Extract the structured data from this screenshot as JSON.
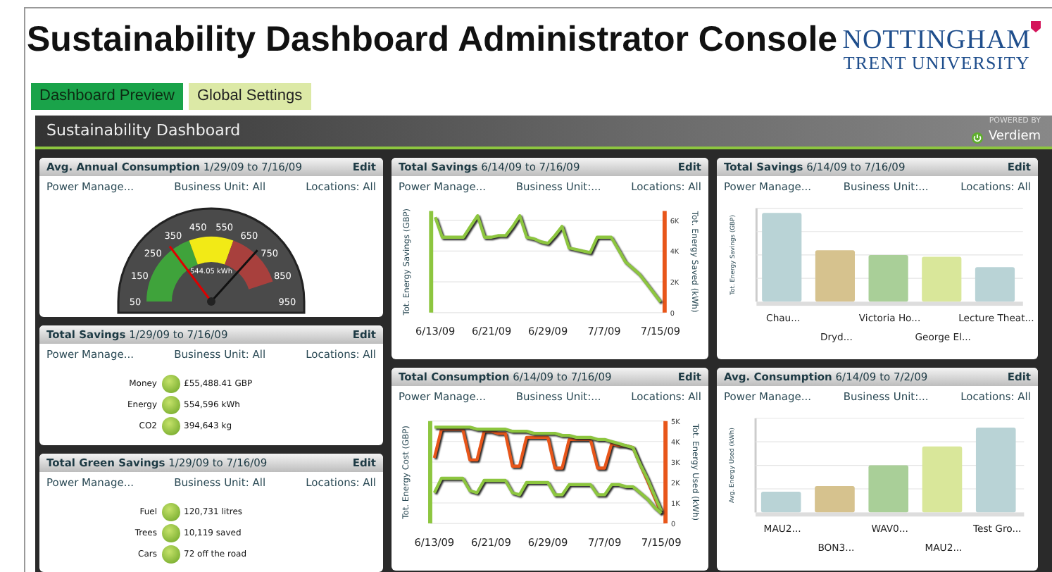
{
  "header": {
    "title": "Sustainability Dashboard Administrator Console",
    "logo": {
      "line1": "NOTTINGHAM",
      "line2": "TRENT UNIVERSITY"
    }
  },
  "tabs": [
    {
      "label": "Dashboard Preview",
      "selected": true
    },
    {
      "label": "Global Settings",
      "selected": false
    }
  ],
  "dashboard": {
    "title": "Sustainability Dashboard",
    "powered_by": "POWERED BY",
    "brand": "Verdiem"
  },
  "columns": [
    [
      {
        "kind": "gauge",
        "title": "Avg. Annual Consumption",
        "dates": "1/29/09 to 7/16/09",
        "edit": "Edit",
        "filters": [
          "Power Manage...",
          "Business Unit: All",
          "Locations: All"
        ],
        "scale": [
          "50",
          "150",
          "250",
          "350",
          "450",
          "550",
          "650",
          "750",
          "850",
          "950"
        ],
        "reading": "544.05 kWh"
      },
      {
        "kind": "stats",
        "title": "Total Savings",
        "dates": "1/29/09 to 7/16/09",
        "edit": "Edit",
        "filters": [
          "Power Manage...",
          "Business Unit: All",
          "Locations: All"
        ],
        "items": [
          {
            "label": "Money",
            "value": "£55,488.41 GBP"
          },
          {
            "label": "Energy",
            "value": "554,596 kWh"
          },
          {
            "label": "CO2",
            "value": "394,643 kg"
          }
        ]
      },
      {
        "kind": "stats",
        "title": "Total Green Savings",
        "dates": "1/29/09 to 7/16/09",
        "edit": "Edit",
        "filters": [
          "Power Manage...",
          "Business Unit: All",
          "Locations: All"
        ],
        "items": [
          {
            "label": "Fuel",
            "value": "120,731 litres"
          },
          {
            "label": "Trees",
            "value": "10,119 saved"
          },
          {
            "label": "Cars",
            "value": "72 off the road"
          }
        ]
      }
    ],
    [
      {
        "kind": "line",
        "title": "Total Savings",
        "dates": "6/14/09 to 7/16/09",
        "edit": "Edit",
        "filters": [
          "Power Manage...",
          "Business Unit:...",
          "Locations: All"
        ],
        "y_left_title": "Tot. Energy Savings (GBP)",
        "chart_data": {
          "type": "line",
          "ylabel": "Tot. Energy Saved (kWh)",
          "ylim": [
            0,
            6600
          ],
          "grid": true,
          "categories": [
            "6/13/09",
            null,
            null,
            null,
            null,
            null,
            null,
            null,
            "6/21/09",
            null,
            null,
            null,
            null,
            null,
            null,
            null,
            "6/29/09",
            null,
            null,
            null,
            null,
            null,
            null,
            null,
            "7/7/09",
            null,
            null,
            null,
            null,
            null,
            null,
            null,
            "7/15/09"
          ],
          "yticks": [
            {
              "value": 6000,
              "label": "6K"
            },
            {
              "value": 4000,
              "label": "4K"
            },
            {
              "value": 2000,
              "label": "2K"
            },
            {
              "value": 0,
              "label": "0"
            }
          ],
          "series": [
            {
              "color": "#8dc63f",
              "values": [
                6200,
                4900,
                4900,
                4900,
                4900,
                5600,
                6300,
                4900,
                4900,
                5000,
                5000,
                5600,
                6300,
                4900,
                4800,
                4600,
                4500,
                5000,
                5600,
                4200,
                4100,
                4000,
                3900,
                4900,
                4900,
                4900,
                4100,
                3300,
                2900,
                2500,
                1900,
                1300,
                700
              ]
            }
          ]
        }
      },
      {
        "kind": "line",
        "title": "Total Consumption",
        "dates": "6/14/09 to 7/16/09",
        "edit": "Edit",
        "filters": [
          "Power Manage...",
          "Business Unit:...",
          "Locations: All"
        ],
        "y_left_title": "Tot. Energy Cost (GBP)",
        "chart_data": {
          "type": "line",
          "ylabel": "Tot. Energy Used (kWh)",
          "ylim": [
            0,
            5000
          ],
          "grid": true,
          "categories": [
            "6/13/09",
            null,
            null,
            null,
            null,
            null,
            null,
            null,
            "6/21/09",
            null,
            null,
            null,
            null,
            null,
            null,
            null,
            "6/29/09",
            null,
            null,
            null,
            null,
            null,
            null,
            null,
            "7/7/09",
            null,
            null,
            null,
            null,
            null,
            null,
            null,
            "7/15/09"
          ],
          "yticks": [
            {
              "value": 5000,
              "label": "5K"
            },
            {
              "value": 4000,
              "label": "4K"
            },
            {
              "value": 3000,
              "label": "3K"
            },
            {
              "value": 2000,
              "label": "2K"
            },
            {
              "value": 1000,
              "label": "1K"
            },
            {
              "value": 0,
              "label": "0"
            }
          ],
          "series": [
            {
              "color": "#e8561a",
              "values": [
                3200,
                4600,
                4600,
                4600,
                4600,
                3100,
                3100,
                4500,
                4500,
                4400,
                4400,
                2800,
                2800,
                4200,
                4200,
                4200,
                4200,
                2700,
                2700,
                4100,
                4100,
                4100,
                4100,
                2700,
                2700,
                3900,
                3800,
                3800,
                3700,
                2900,
                2100,
                1300,
                500
              ]
            },
            {
              "color": "#8dc63f",
              "values": [
                4700,
                4700,
                4700,
                4700,
                4700,
                4700,
                4600,
                4600,
                4600,
                4600,
                4600,
                4500,
                4500,
                4500,
                4400,
                4400,
                4400,
                4400,
                4300,
                4300,
                4200,
                4200,
                4200,
                4100,
                4100,
                4000,
                3900,
                3800,
                3700,
                2900,
                2200,
                1400,
                600
              ]
            },
            {
              "color": "#8dc63f",
              "values": [
                1500,
                2200,
                2200,
                2200,
                2200,
                1600,
                1500,
                2100,
                2100,
                2100,
                2100,
                1500,
                1400,
                2000,
                2000,
                2000,
                2000,
                1400,
                1400,
                1900,
                1900,
                1900,
                1900,
                1400,
                1400,
                1900,
                1900,
                1800,
                1800,
                1500,
                1200,
                800,
                500
              ]
            }
          ]
        }
      }
    ],
    [
      {
        "kind": "bar",
        "title": "Total Savings",
        "dates": "6/14/09 to 7/16/09",
        "edit": "Edit",
        "filters": [
          "Power Manage...",
          "Business Unit:...",
          "Locations: All"
        ],
        "y_title": "Tot. Energy Savings (GBP)",
        "bars": [
          {
            "label": "Chau...",
            "color": "#b9d3d6"
          },
          {
            "label": "Dryd...",
            "color": "#d6c28e"
          },
          {
            "label": "Victoria Ho...",
            "color": "#a9cf98"
          },
          {
            "label": "George El...",
            "color": "#d9e79a"
          },
          {
            "label": "Lecture Theat...",
            "color": "#b9d3d6"
          }
        ]
      },
      {
        "kind": "bar",
        "title": "Avg. Consumption",
        "dates": "6/14/09 to 7/2/09",
        "edit": "Edit",
        "filters": [
          "Power Manage...",
          "Business Unit:...",
          "Locations: All"
        ],
        "y_title": "Avg. Energy Used (kWh)",
        "bars": [
          {
            "label": "MAU2...",
            "color": "#b9d3d6"
          },
          {
            "label": "BON3...",
            "color": "#d6c28e"
          },
          {
            "label": "WAV0...",
            "color": "#a9cf98"
          },
          {
            "label": "MAU2...",
            "color": "#d9e79a"
          },
          {
            "label": "Test Gro...",
            "color": "#b9d3d6"
          }
        ]
      }
    ]
  ]
}
